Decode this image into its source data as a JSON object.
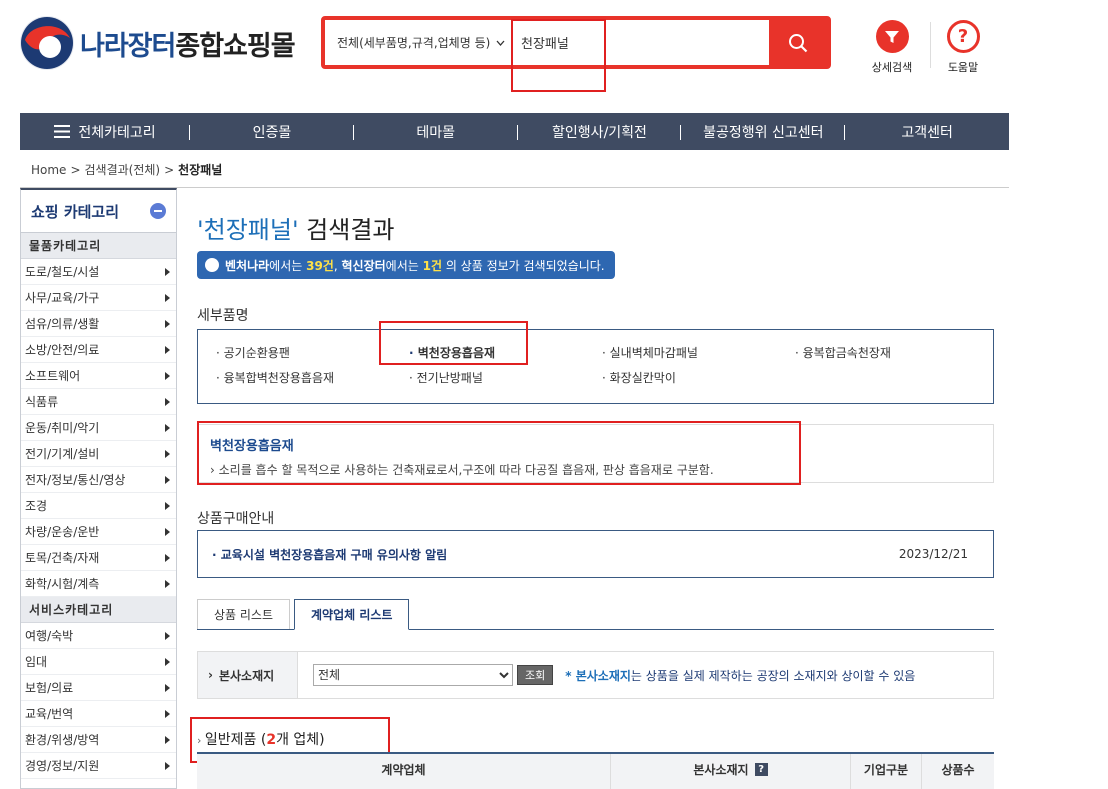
{
  "header": {
    "logo_part_a": "나라장터",
    "logo_part_b": "종합쇼핑몰",
    "search_scope": "전체(세부품명,규격,업체명 등)",
    "search_value": "천장패널",
    "detail_search_label": "상세검색",
    "help_label": "도움말"
  },
  "gnb": {
    "all_categories": "전체카테고리",
    "items": [
      "인증몰",
      "테마몰",
      "할인행사/기획전",
      "불공정행위 신고센터",
      "고객센터"
    ]
  },
  "breadcrumb": [
    "Home",
    "검색결과(전체)",
    "천장패널"
  ],
  "sidebar": {
    "title": "쇼핑 카테고리",
    "goods_section": "물품카테고리",
    "goods_items": [
      "도로/철도/시설",
      "사무/교육/가구",
      "섬유/의류/생활",
      "소방/안전/의료",
      "소프트웨어",
      "식품류",
      "운동/취미/악기",
      "전기/기계/설비",
      "전자/정보/통신/영상",
      "조경",
      "차량/운송/운반",
      "토목/건축/자재",
      "화학/시험/계측"
    ],
    "service_section": "서비스카테고리",
    "service_items": [
      "여행/숙박",
      "임대",
      "보험/의료",
      "교육/번역",
      "환경/위생/방역",
      "경영/정보/지원"
    ]
  },
  "main": {
    "title_quote_open": "'",
    "title_keyword": "천장패널",
    "title_quote_close": "'",
    "title_suffix": " 검색결과",
    "notice": {
      "venture_label": "벤처나라",
      "venture_mid": "에서는 ",
      "venture_count": "39건",
      "sep": ", ",
      "innov_label": "혁신장터",
      "innov_mid": "에서는 ",
      "innov_count": "1건",
      "tail": " 의 상품 정보가 검색되었습니다."
    },
    "detail_items_label": "세부품명",
    "detail_items": [
      "공기순환용팬",
      "벽천장용흡음재",
      "실내벽체마감패널",
      "융복합금속천장재",
      "융복합벽천장용흡음재",
      "전기난방패널",
      "화장실칸막이"
    ],
    "definition_title": "벽천장용흡음재",
    "definition_text": "소리를 흡수 할 목적으로 사용하는 건축재료로서,구조에 따라 다공질 흡음재, 판상 흡음재로 구분함.",
    "guide_label": "상품구매안내",
    "guide_title": "교육시설 벽천장용흡음재 구매 유의사항 알림",
    "guide_date": "2023/12/21",
    "tabs": [
      "상품 리스트",
      "계약업체 리스트"
    ],
    "filter_label": "본사소재지",
    "filter_select": "전체",
    "filter_button": "조회",
    "filter_note_key": "* 본사소재지",
    "filter_note_rest": "는 상품을 실제 제작하는 공장의 소재지와 상이할 수 있음",
    "general_title_prefix": "일반제품 (",
    "general_count": "2",
    "general_title_suffix": "개 업체)",
    "table_headers": [
      "계약업체",
      "본사소재지",
      "기업구분",
      "상품수"
    ],
    "help_q": "?"
  },
  "colors": {
    "accent_red": "#e8332a",
    "nav_bg": "#3f4b62",
    "link_blue": "#1d4b8f",
    "notice_blue": "#2e67b1",
    "highlight_yellow": "#ffe148"
  }
}
